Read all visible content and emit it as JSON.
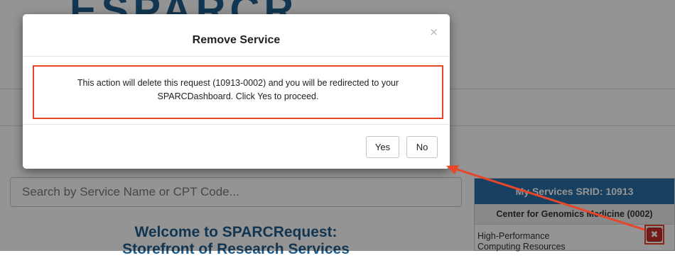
{
  "page": {
    "logo_text": "ESPARCR",
    "search_placeholder": "Search by Service Name or CPT Code...",
    "welcome_line1": "Welcome to SPARCRequest:",
    "welcome_line2": "Storefront of Research Services"
  },
  "services_panel": {
    "title": "My Services SRID: 10913",
    "provider": "Center for Genomics Medicine (0002)",
    "service_name": "High-Performance Computing Resources",
    "remove_icon": "times-icon"
  },
  "modal": {
    "title": "Remove Service",
    "close_symbol": "×",
    "message_line1": "This action will delete this request (10913-0002) and you will be redirected to your",
    "message_line2": "SPARCDashboard. Click Yes to proceed.",
    "yes_label": "Yes",
    "no_label": "No"
  },
  "colors": {
    "brand_blue": "#1f5d8c",
    "panel_header": "#2a6fa6",
    "danger": "#c9302c",
    "annotation_red": "#e8462a"
  }
}
